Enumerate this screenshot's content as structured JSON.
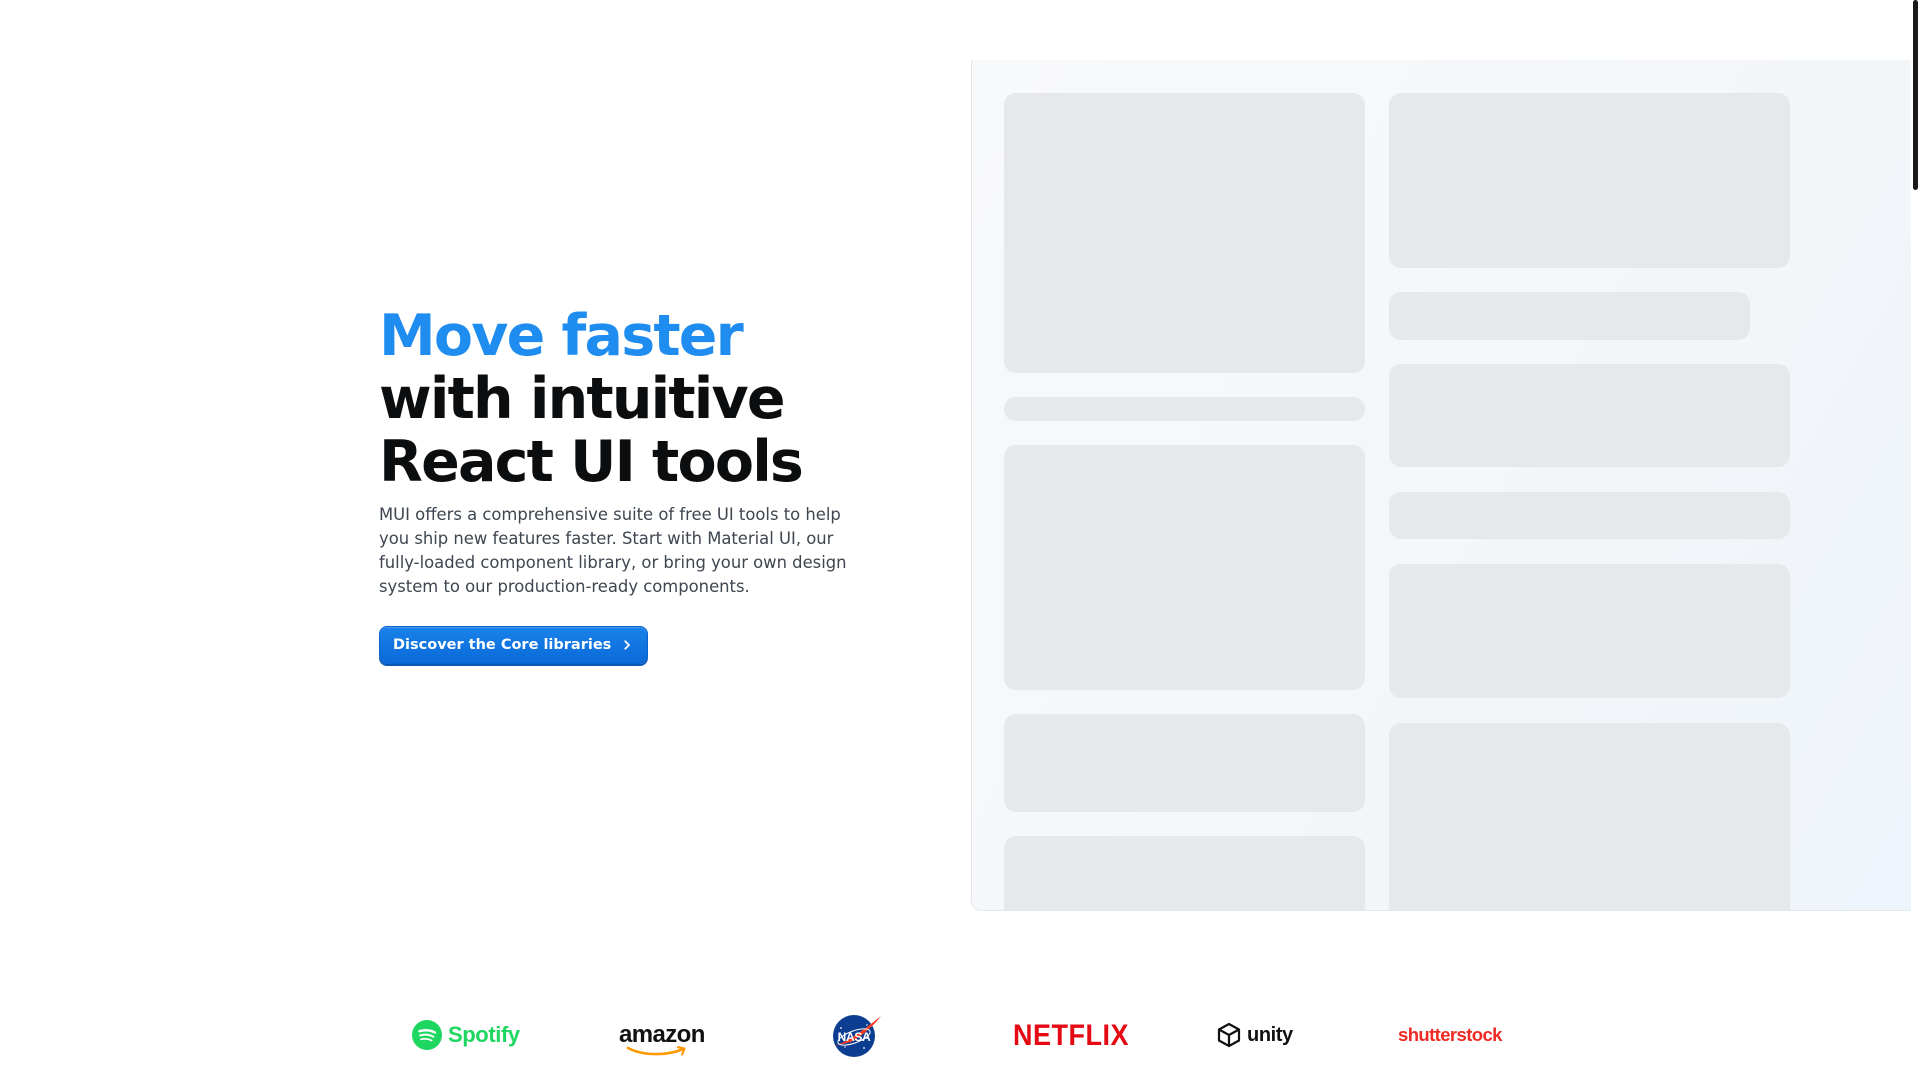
{
  "hero": {
    "headline_line1": "Move faster",
    "headline_line2": "with intuitive",
    "headline_line3": "React UI tools",
    "description": "MUI offers a comprehensive suite of free UI tools to help you ship new features faster. Start with Material UI, our fully-loaded component library, or bring your own design system to our production-ready components.",
    "cta_label": "Discover the Core libraries",
    "cta_icon": "chevron-right-icon"
  },
  "showcase": {
    "state": "loading-skeleton"
  },
  "logos": [
    {
      "name": "Spotify",
      "icon": "spotify-icon"
    },
    {
      "name": "amazon",
      "icon": "amazon-smile-icon"
    },
    {
      "name": "NASA",
      "icon": "nasa-meatball-icon"
    },
    {
      "name": "NETFLIX",
      "icon": ""
    },
    {
      "name": "unity",
      "icon": "unity-cube-icon"
    },
    {
      "name": "shutterstock",
      "icon": ""
    }
  ],
  "colors": {
    "accent": "#1f8cf0",
    "cta": "#0b6bd8",
    "headline": "#0b0d0e",
    "skeleton": "#e6e8ec",
    "spotify": "#1ed760",
    "netflix": "#e50914",
    "shutterstock": "#ee2b24"
  }
}
